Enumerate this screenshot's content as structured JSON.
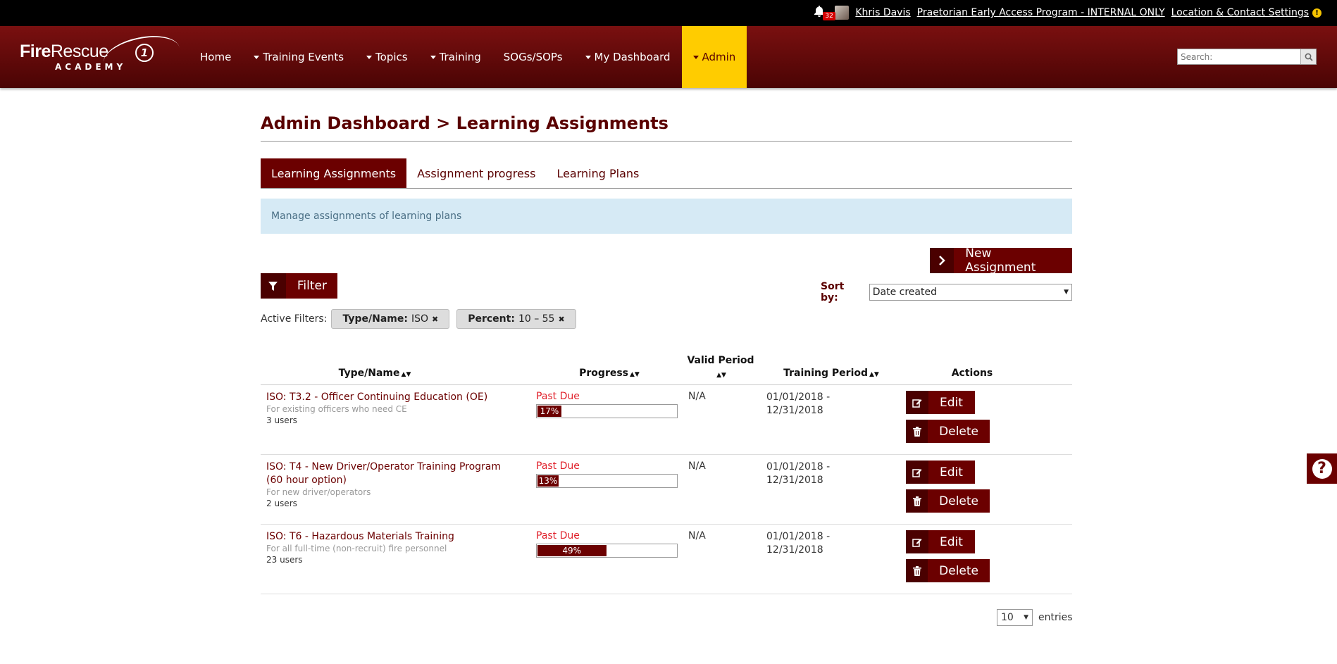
{
  "topbar": {
    "notification_count": "32",
    "user_name": "Khris Davis",
    "program_link": "Praetorian Early Access Program - INTERNAL ONLY",
    "settings_link": "Location & Contact Settings",
    "warning_glyph": "!"
  },
  "logo": {
    "line1_bold": "Fire",
    "line1_thin": "Rescue",
    "number": "1",
    "line2": "ACADEMY"
  },
  "nav": {
    "items": [
      {
        "label": "Home",
        "dropdown": false
      },
      {
        "label": "Training Events",
        "dropdown": true
      },
      {
        "label": "Topics",
        "dropdown": true
      },
      {
        "label": "Training",
        "dropdown": true
      },
      {
        "label": "SOGs/SOPs",
        "dropdown": false
      },
      {
        "label": "My Dashboard",
        "dropdown": true
      },
      {
        "label": "Admin",
        "dropdown": true,
        "active": true
      }
    ],
    "search_placeholder": "Search:"
  },
  "page": {
    "title": "Admin Dashboard > Learning Assignments",
    "tabs": [
      {
        "label": "Learning Assignments",
        "active": true
      },
      {
        "label": "Assignment progress"
      },
      {
        "label": "Learning Plans"
      }
    ],
    "info": "Manage assignments of learning plans",
    "new_button": "New Assignment",
    "filter_button": "Filter",
    "sort_label": "Sort by:",
    "sort_value": "Date created",
    "active_filters_label": "Active Filters:",
    "filters": [
      {
        "key": "Type/Name:",
        "value": "ISO"
      },
      {
        "key": "Percent:",
        "value": "10 – 55"
      }
    ]
  },
  "table": {
    "headers": {
      "type_name": "Type/Name",
      "progress": "Progress",
      "valid_period": "Valid Period",
      "training_period": "Training Period",
      "actions": "Actions"
    },
    "rows": [
      {
        "title": "ISO: T3.2 - Officer Continuing Education (OE)",
        "desc": "For existing officers who need CE",
        "users": "3 users",
        "status": "Past Due",
        "percent": 17,
        "percent_label": "17%",
        "valid": "N/A",
        "period_start": "01/01/2018 -",
        "period_end": "12/31/2018",
        "edit": "Edit",
        "delete": "Delete"
      },
      {
        "title": "ISO: T4 - New Driver/Operator Training Program (60 hour option)",
        "desc": "For new driver/operators",
        "users": "2 users",
        "status": "Past Due",
        "percent": 13,
        "percent_label": "13%",
        "valid": "N/A",
        "period_start": "01/01/2018 -",
        "period_end": "12/31/2018",
        "edit": "Edit",
        "delete": "Delete"
      },
      {
        "title": "ISO: T6 - Hazardous Materials Training",
        "desc": "For all full-time (non-recruit) fire personnel",
        "users": "23 users",
        "status": "Past Due",
        "percent": 49,
        "percent_label": "49%",
        "valid": "N/A",
        "period_start": "01/01/2018 -",
        "period_end": "12/31/2018",
        "edit": "Edit",
        "delete": "Delete"
      }
    ]
  },
  "pagination": {
    "per_page": "10",
    "entries_label": "entries"
  },
  "help": {
    "glyph": "?"
  },
  "colors": {
    "brand": "#6b0000",
    "active_nav": "#ffcc00",
    "past_due": "#e0202a",
    "info_bg": "#d6eaf5"
  }
}
